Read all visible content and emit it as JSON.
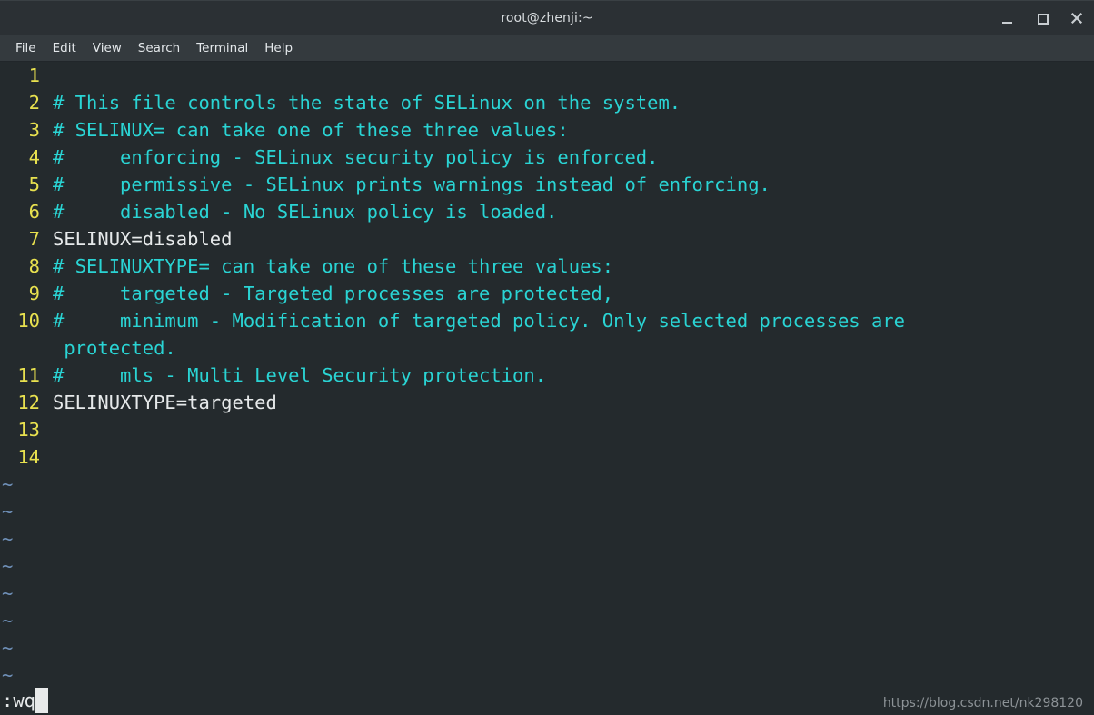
{
  "window": {
    "title": "root@zhenji:~",
    "controls": [
      {
        "name": "minimize",
        "glyph": "_"
      },
      {
        "name": "maximize",
        "glyph": "□"
      },
      {
        "name": "close",
        "glyph": "✕"
      }
    ]
  },
  "menubar": {
    "items": [
      "File",
      "Edit",
      "View",
      "Search",
      "Terminal",
      "Help"
    ]
  },
  "editor": {
    "lines": [
      {
        "num": "1",
        "text": "",
        "style": "plain"
      },
      {
        "num": "2",
        "text": "# This file controls the state of SELinux on the system.",
        "style": "comment"
      },
      {
        "num": "3",
        "text": "# SELINUX= can take one of these three values:",
        "style": "comment"
      },
      {
        "num": "4",
        "text": "#     enforcing - SELinux security policy is enforced.",
        "style": "comment"
      },
      {
        "num": "5",
        "text": "#     permissive - SELinux prints warnings instead of enforcing.",
        "style": "comment"
      },
      {
        "num": "6",
        "text": "#     disabled - No SELinux policy is loaded.",
        "style": "comment"
      },
      {
        "num": "7",
        "text": "SELINUX=disabled",
        "style": "plain"
      },
      {
        "num": "8",
        "text": "# SELINUXTYPE= can take one of these three values:",
        "style": "comment"
      },
      {
        "num": "9",
        "text": "#     targeted - Targeted processes are protected,",
        "style": "comment"
      },
      {
        "num": "10",
        "text": "#     minimum - Modification of targeted policy. Only selected processes are",
        "style": "comment"
      },
      {
        "num": "",
        "text": " protected.",
        "style": "comment"
      },
      {
        "num": "11",
        "text": "#     mls - Multi Level Security protection.",
        "style": "comment"
      },
      {
        "num": "12",
        "text": "SELINUXTYPE=targeted",
        "style": "plain"
      },
      {
        "num": "13",
        "text": "",
        "style": "plain"
      },
      {
        "num": "14",
        "text": "",
        "style": "plain"
      }
    ],
    "filler_tilde": "~",
    "filler_count": 8
  },
  "statusline": {
    "command": ":wq",
    "watermark": "https://blog.csdn.net/nk298120"
  },
  "colors": {
    "terminal_bg": "#242a2d",
    "titlebar_bg": "#2b3034",
    "menubar_bg": "#343a3e",
    "line_number": "#e8e14f",
    "comment": "#2ad4d4",
    "plain_text": "#e6e9ea",
    "tilde": "#6f90b8",
    "cursor": "#e8eaea",
    "watermark": "#8d9397"
  }
}
